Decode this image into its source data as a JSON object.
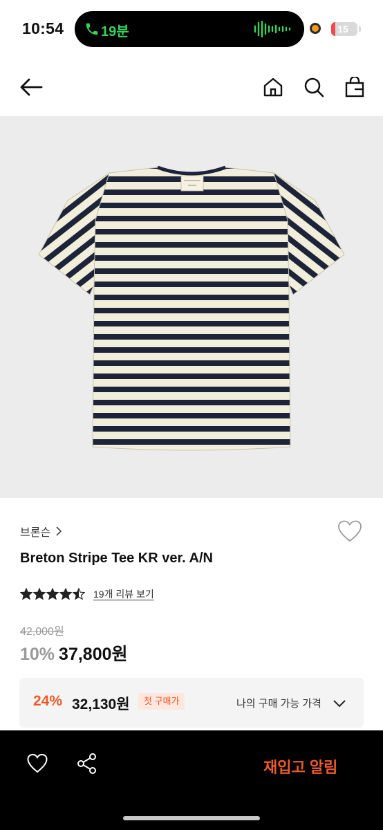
{
  "status_bar": {
    "time": "10:54",
    "call_duration": "19분",
    "battery_level": "15",
    "battery_fraction": 0.15,
    "call_color": "#3bd05e"
  },
  "nav": {
    "back_icon": "arrow-left-icon",
    "home_icon": "home-icon",
    "search_icon": "search-icon",
    "bag_icon": "shopping-bag-icon"
  },
  "product": {
    "image": "breton-stripe-tee-photo",
    "brand": "브론슨",
    "name": "Breton Stripe Tee KR ver. A/N",
    "rating": 4.5,
    "review_text": "19개 리뷰 보기",
    "original_price": "42,000원",
    "discount_rate": "10%",
    "sale_price": "37,800원"
  },
  "coupon": {
    "rate": "24%",
    "price": "32,130원",
    "badge": "첫 구매가",
    "my_price_label": "나의 구매 가능 가격"
  },
  "bottom_bar": {
    "restock_label": "재입고 알림",
    "accent_color": "#ec5a2b"
  }
}
